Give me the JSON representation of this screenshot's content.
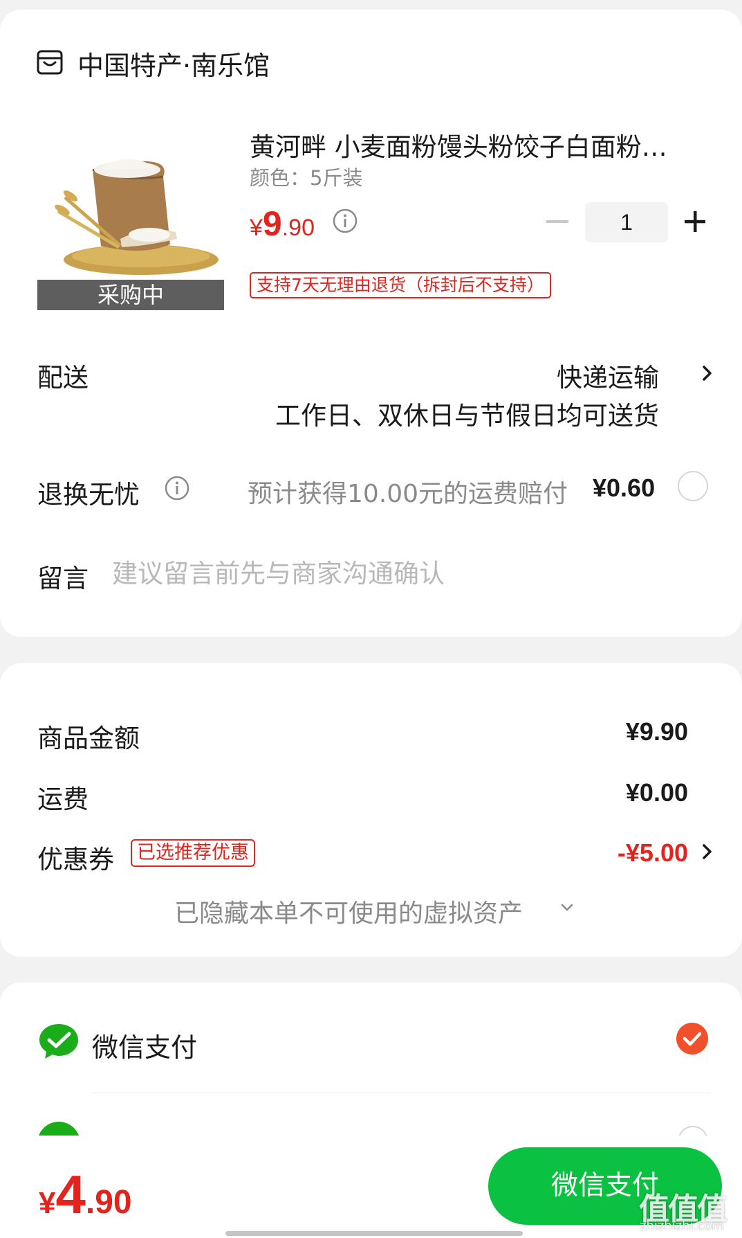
{
  "store": {
    "name": "中国特产·南乐馆",
    "icon": "store-icon"
  },
  "product": {
    "title": "黄河畔 小麦面粉馒头粉饺子白面粉…",
    "spec": "颜色：5斤装",
    "image_badge": "采购中",
    "price_currency": "¥",
    "price_int": "9",
    "price_dec": ".90",
    "quantity": "1",
    "return_policy": "支持7天无理由退货（拆封后不支持）"
  },
  "delivery": {
    "label": "配送",
    "method": "快递运输",
    "schedule": "工作日、双休日与节假日均可送货"
  },
  "exchange": {
    "label": "退换无忧",
    "description": "预计获得10.00元的运费赔付",
    "price": "¥0.60"
  },
  "message": {
    "label": "留言",
    "placeholder": "建议留言前先与商家沟通确认"
  },
  "summary": {
    "goods_label": "商品金额",
    "goods_value": "¥9.90",
    "shipping_label": "运费",
    "shipping_value": "¥0.00",
    "coupon_label": "优惠券",
    "coupon_tag": "已选推荐优惠",
    "coupon_value": "-¥5.00",
    "hidden_assets": "已隐藏本单不可使用的虚拟资产"
  },
  "payment": {
    "option1_label": "微信支付",
    "option1_selected": true
  },
  "footer": {
    "total_currency": "¥",
    "total_int": "4",
    "total_dec": ".90",
    "pay_button": "微信支付"
  },
  "watermark": {
    "logo": "值值值",
    "url": "zhizhizhi.com"
  },
  "colors": {
    "accent_red": "#e4231d",
    "wechat_green": "#0bc142",
    "icon_green": "#1aad19"
  }
}
